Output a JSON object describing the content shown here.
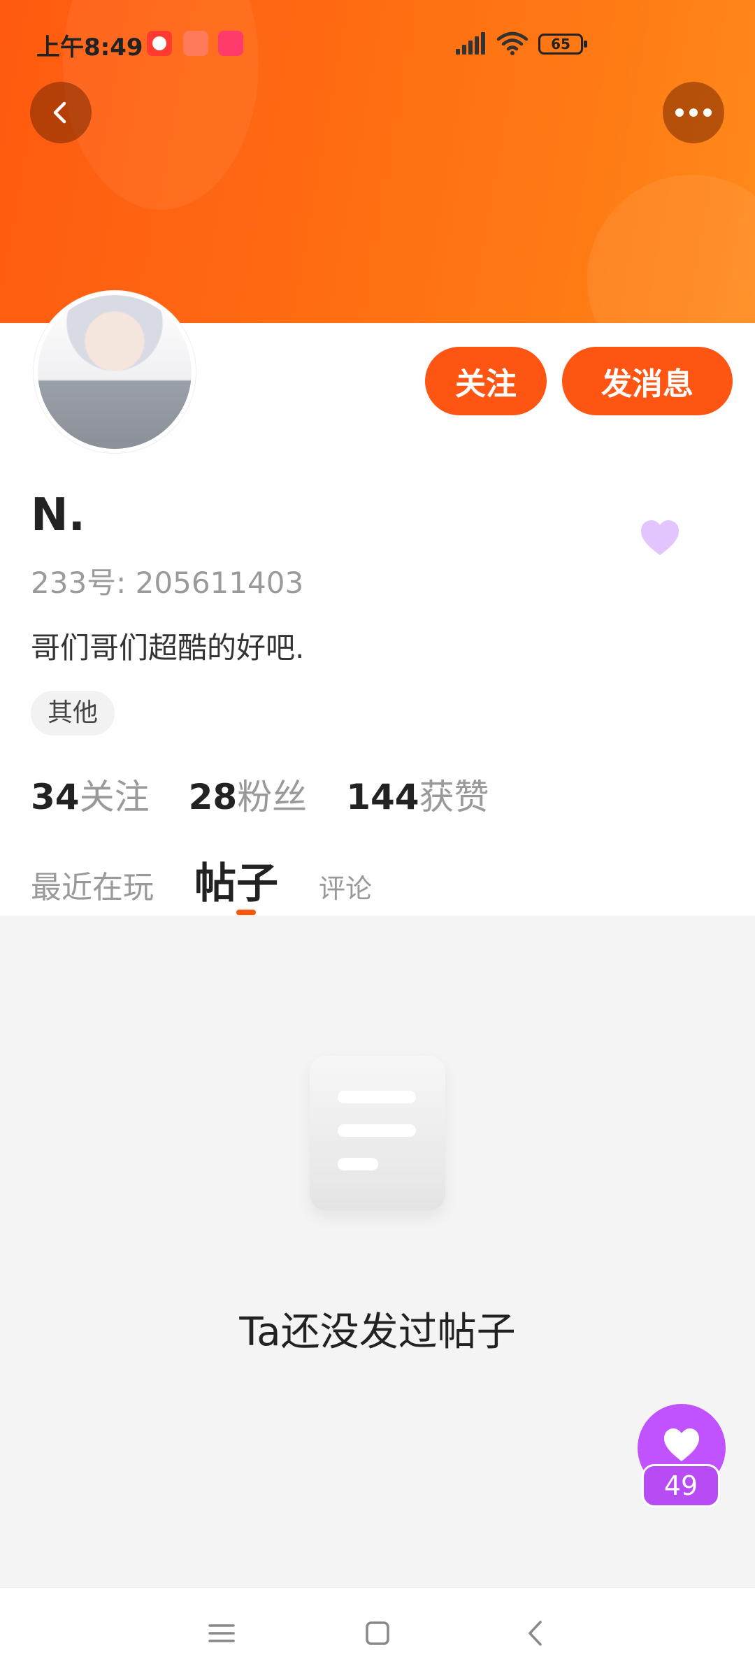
{
  "status_bar": {
    "time": "上午8:49",
    "battery": "65"
  },
  "profile": {
    "name": "N.",
    "uid": "233号: 205611403",
    "bio": "哥们哥们超酷的好吧.",
    "tag": "其他",
    "follow_label": "关注",
    "message_label": "发消息"
  },
  "stats": [
    {
      "num": "34",
      "label": "关注"
    },
    {
      "num": "28",
      "label": "粉丝"
    },
    {
      "num": "144",
      "label": "获赞"
    }
  ],
  "tabs": [
    {
      "label": "最近在玩",
      "active": false
    },
    {
      "label": "帖子",
      "active": true
    },
    {
      "label": "评论",
      "active": false
    }
  ],
  "empty_state": {
    "text": "Ta还没发过帖子"
  },
  "like_fab": {
    "count": "49"
  },
  "icons": {
    "back": "chevron-left-icon",
    "more": "more-dots-icon",
    "heart": "heart-icon"
  },
  "colors": {
    "accent": "#ff5512",
    "banner_start": "#ff5a10",
    "banner_end": "#ff8a1c",
    "like_purple": "#c052ff"
  }
}
